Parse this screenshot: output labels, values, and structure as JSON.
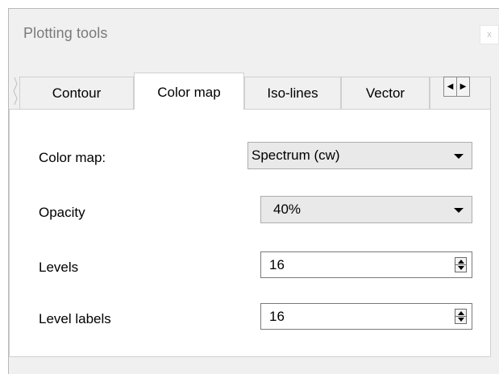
{
  "window": {
    "title": "Plotting tools",
    "close_label": "x"
  },
  "tabs": [
    {
      "label": "Contour",
      "active": false
    },
    {
      "label": "Color map",
      "active": true
    },
    {
      "label": "Iso-lines",
      "active": false
    },
    {
      "label": "Vector",
      "active": false
    }
  ],
  "tab_scroll": {
    "left_icon": "left-arrow-icon",
    "right_icon": "right-arrow-icon"
  },
  "color_map_panel": {
    "color_map": {
      "label": "Color map:",
      "value": "Spectrum (cw)"
    },
    "opacity": {
      "label": "Opacity",
      "value": "40%"
    },
    "levels": {
      "label": "Levels",
      "value": "16"
    },
    "level_labels": {
      "label": "Level labels",
      "value": "16"
    }
  }
}
